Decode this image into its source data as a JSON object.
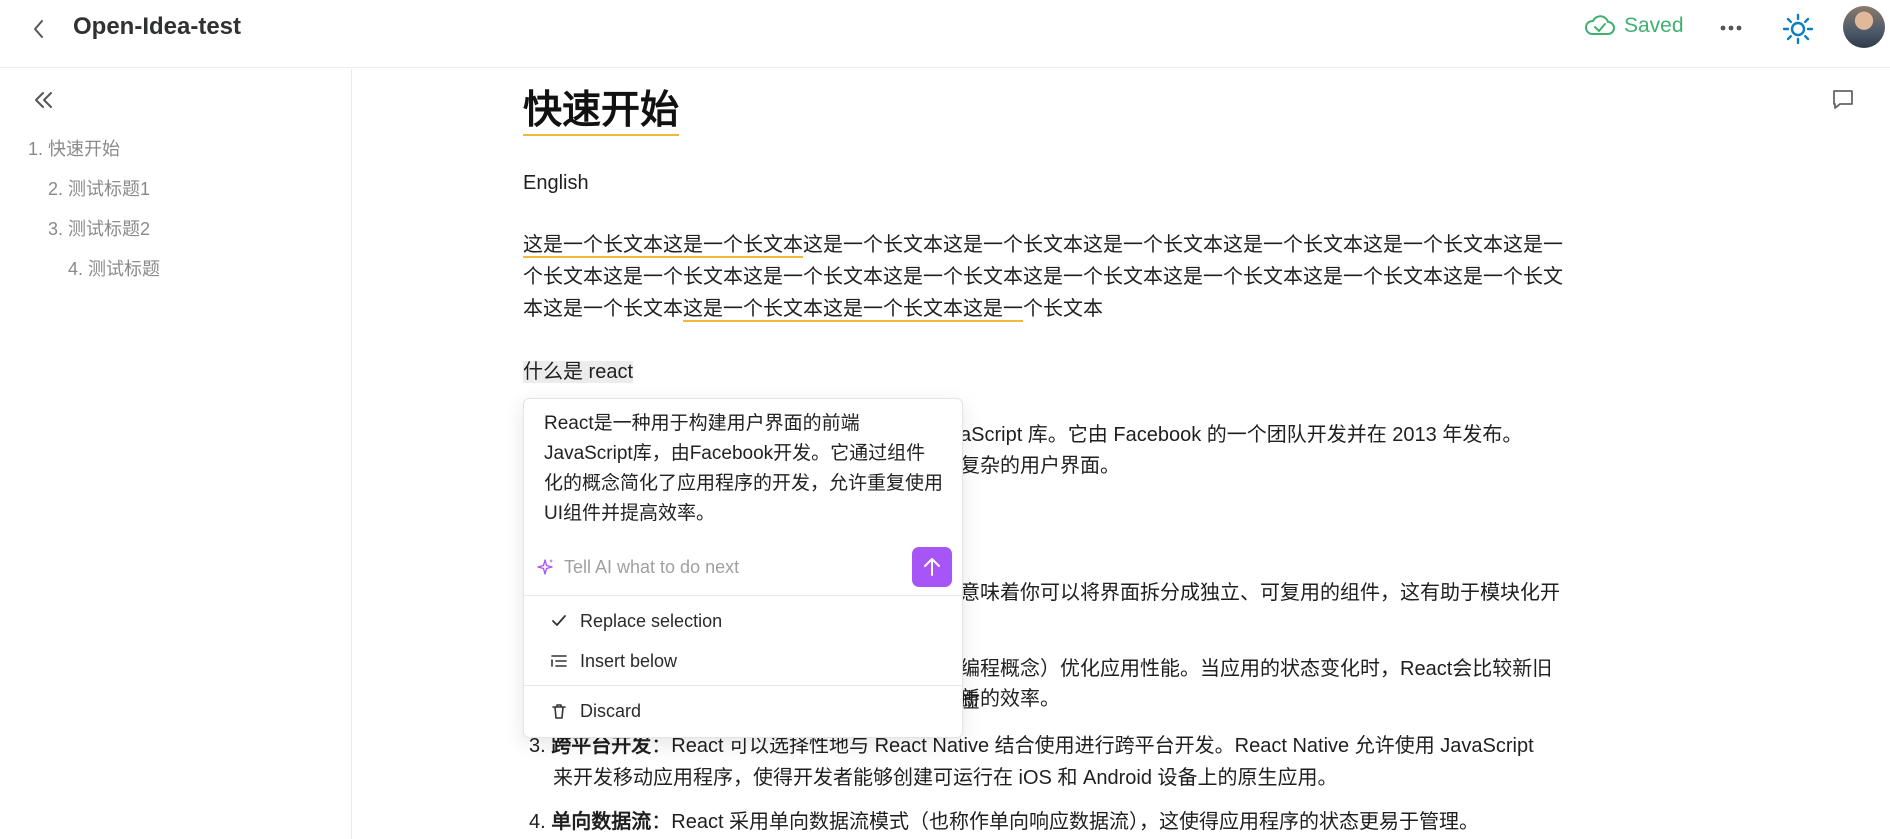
{
  "header": {
    "title": "Open-Idea-test",
    "saved_label": "Saved",
    "colors": {
      "saved": "#3fb06f",
      "accent": "#0a7fc1"
    },
    "icons": [
      "back-arrow-icon",
      "cloud-check-icon",
      "more-horizontal-icon",
      "sun-icon"
    ]
  },
  "sidebar": {
    "items": [
      {
        "label": "1. 快速开始"
      },
      {
        "label": "2. 测试标题1"
      },
      {
        "label": "3. 测试标题2"
      },
      {
        "label": "4. 测试标题"
      }
    ]
  },
  "doc": {
    "heading": "快速开始",
    "english": "English",
    "long_text": {
      "line1_hl": "这是一个长文本这是一个长文本",
      "line1_rest": "这是一个长文本这是一个长文本这是一个长文本这是一个长文本这是一个长文本这是一",
      "line2": "个长文本这是一个长文本这是一个长文本这是一个长文本这是一个长文本这是一个长文本这是一个长文本这是一个长文",
      "line3_a": "本这是一个长文本",
      "line3_hl": "这是一个长文本这是一个长文本这是一",
      "line3_b": "个长文本"
    },
    "selected": "什么是 react",
    "para_tail_1a": "aScript 库。它由 Facebook 的一个团队开发并在 2013 年发布。",
    "para_tail_1b": "复杂的用户界面。",
    "para_tail_2a": "意味着你可以将界面拆分成独立、可复用的组件，这有助于模块化开",
    "para_tail_3a": "编程概念）优化应用性能。当应用的状态变化时，React会比较新旧虚",
    "para_tail_3b": "新的效率。",
    "list": [
      {
        "num": "3.",
        "title": "跨平台开发",
        "text": "：React 可以选择性地与 React Native 结合使用进行跨平台开发。React Native 允许使用 JavaScript",
        "cont": "来开发移动应用程序，使得开发者能够创建可运行在 iOS 和 Android 设备上的原生应用。"
      },
      {
        "num": "4.",
        "title": "单向数据流",
        "text": "：React 采用单向数据流模式（也称作单向响应数据流），这使得应用程序的状态更易于管理。"
      }
    ]
  },
  "ai": {
    "answer": "React是一种用于构建用户界面的前端JavaScript库，由Facebook开发。它通过组件化的概念简化了应用程序的开发，允许重复使用UI组件并提高效率。",
    "placeholder": "Tell AI what to do next",
    "menu": {
      "replace": "Replace selection",
      "insert": "Insert below",
      "discard": "Discard"
    },
    "colors": {
      "send": "#a855f7"
    }
  }
}
